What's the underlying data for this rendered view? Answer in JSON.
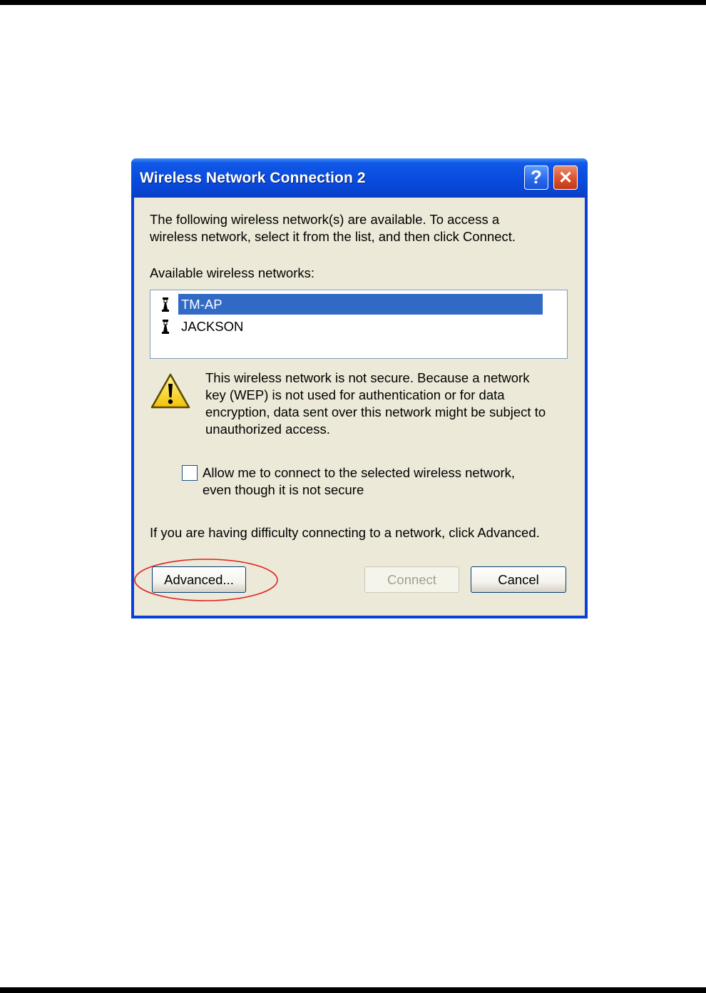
{
  "window": {
    "title": "Wireless Network Connection 2",
    "help_glyph": "?",
    "close_glyph": "✕"
  },
  "intro": {
    "line1": "The following wireless network(s) are available. To access a",
    "line2": "wireless network, select it from the list, and then click Connect."
  },
  "networks": {
    "label": "Available wireless networks:",
    "items": [
      {
        "name": "TM-AP",
        "selected": true,
        "icon": "wireless-antenna-icon"
      },
      {
        "name": "JACKSON",
        "selected": false,
        "icon": "wireless-antenna-icon"
      }
    ]
  },
  "warning": {
    "icon": "warning-icon",
    "line1": "This wireless network is not secure. Because a network",
    "line2": "key (WEP) is not used for authentication or for data",
    "line3": "encryption, data sent over this network might be subject to",
    "line4": "unauthorized access."
  },
  "allow_checkbox": {
    "checked": false,
    "line1": "Allow me to connect to the selected wireless network,",
    "line2": "even though it is not secure"
  },
  "help_text": "If you are having difficulty connecting to a network, click Advanced.",
  "buttons": {
    "advanced": "Advanced...",
    "connect": "Connect",
    "cancel": "Cancel"
  },
  "colors": {
    "selection": "#316ac5",
    "highlight_annotation": "#e0201e",
    "dialog_bg": "#ece9d8"
  }
}
